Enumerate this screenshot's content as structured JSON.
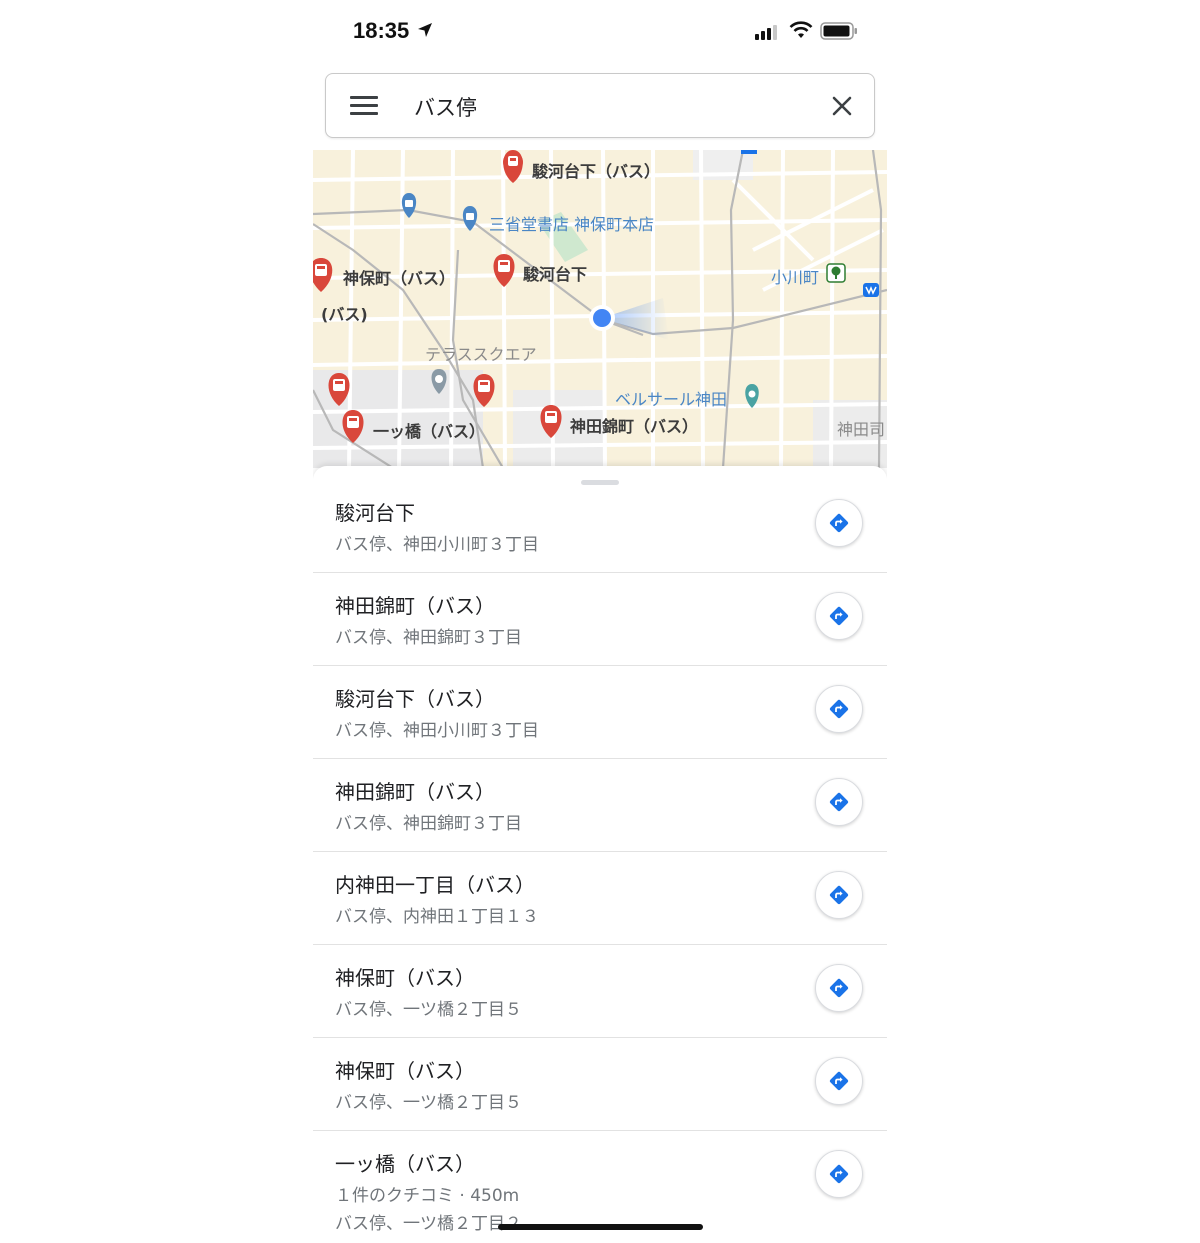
{
  "status_bar": {
    "time": "18:35"
  },
  "search": {
    "query": "バス停"
  },
  "map": {
    "labels": {
      "surugadai_bus_top": "駿河台下（バス）",
      "sanseido": "三省堂書店 神保町本店",
      "jimbocho_bus": "神保町（バス）",
      "jimbocho_bus_cont": "(バス)",
      "surugadai": "駿河台下",
      "ogawamachi": "小川町",
      "terrace_square": "テラススクエア",
      "bellesalle": "ベルサール神田",
      "hitotsubashi_bus": "一ッ橋（バス）",
      "kanda_nishikicho_bus": "神田錦町（バス）",
      "kanda_tsukasa": "神田司"
    },
    "colors": {
      "map_bg": "#f8f1dc",
      "road": "#ffffff",
      "bus_pin": "#d9473b",
      "poi_pin": "#4a86c5",
      "user_dot": "#4285f4"
    }
  },
  "results": [
    {
      "name": "駿河台下",
      "address": "バス停、神田小川町３丁目"
    },
    {
      "name": "神田錦町（バス）",
      "address": "バス停、神田錦町３丁目"
    },
    {
      "name": "駿河台下（バス）",
      "address": "バス停、神田小川町３丁目"
    },
    {
      "name": "神田錦町（バス）",
      "address": "バス停、神田錦町３丁目"
    },
    {
      "name": "内神田一丁目（バス）",
      "address": "バス停、内神田１丁目１３"
    },
    {
      "name": "神保町（バス）",
      "address": "バス停、一ツ橋２丁目５"
    },
    {
      "name": "神保町（バス）",
      "address": "バス停、一ツ橋２丁目５"
    },
    {
      "name": "一ッ橋（バス）",
      "reviews": "１件のクチコミ · 450m",
      "address": "バス停、一ツ橋２丁目２"
    }
  ],
  "icons": {
    "menu": "hamburger-menu-icon",
    "close": "close-icon",
    "directions": "directions-icon",
    "bus": "bus-icon"
  }
}
